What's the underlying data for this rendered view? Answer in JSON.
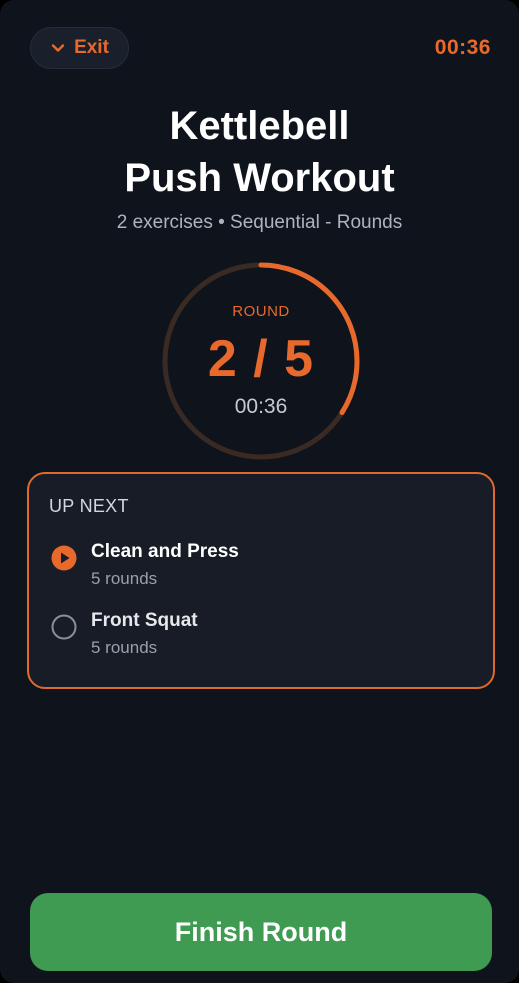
{
  "header": {
    "exit_label": "Exit",
    "elapsed_time": "00:36"
  },
  "workout": {
    "title_line1": "Kettlebell",
    "title_line2": "Push Workout",
    "subtitle": "2 exercises • Sequential - Rounds"
  },
  "round": {
    "label": "ROUND",
    "count_text": "2 / 5",
    "current": 2,
    "total": 5,
    "timer": "00:36",
    "progress_fraction": 0.34
  },
  "up_next": {
    "header": "UP NEXT",
    "items": [
      {
        "name": "Clean and Press",
        "detail": "5 rounds",
        "state": "active"
      },
      {
        "name": "Front Squat",
        "detail": "5 rounds",
        "state": "pending"
      }
    ]
  },
  "actions": {
    "finish_label": "Finish Round"
  },
  "colors": {
    "accent": "#e8692c",
    "background": "#0f131c",
    "card": "#171c26",
    "success": "#3f9b52",
    "ring_track": "#3a2a24"
  }
}
